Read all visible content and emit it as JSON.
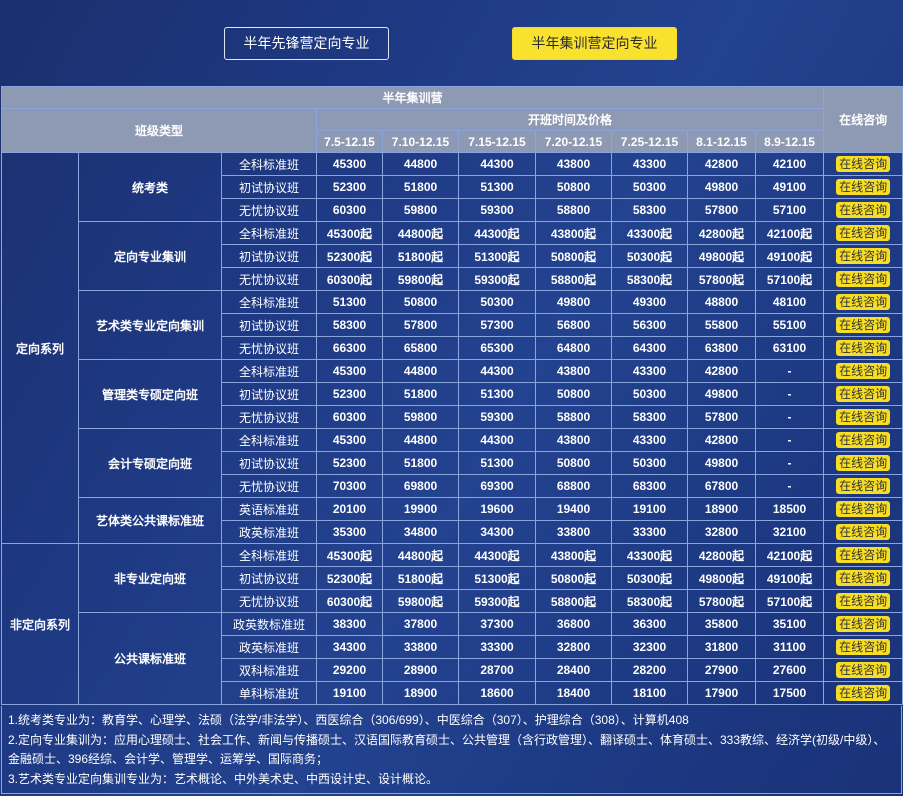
{
  "tabs": [
    {
      "label": "半年先锋营定向专业",
      "active": false
    },
    {
      "label": "半年集训营定向专业",
      "active": true
    }
  ],
  "table": {
    "title": "半年集训营",
    "class_type_header": "班级类型",
    "time_price_header": "开班时间及价格",
    "consult_header": "在线咨询",
    "periods": [
      "7.5-12.15",
      "7.10-12.15",
      "7.15-12.15",
      "7.20-12.15",
      "7.25-12.15",
      "8.1-12.15",
      "8.9-12.15"
    ],
    "consult_label": "在线咨询",
    "series": [
      {
        "name": "定向系列",
        "groups": [
          {
            "name": "统考类",
            "rows": [
              {
                "cls": "全科标准班",
                "prices": [
                  "45300",
                  "44800",
                  "44300",
                  "43800",
                  "43300",
                  "42800",
                  "42100"
                ]
              },
              {
                "cls": "初试协议班",
                "prices": [
                  "52300",
                  "51800",
                  "51300",
                  "50800",
                  "50300",
                  "49800",
                  "49100"
                ]
              },
              {
                "cls": "无忧协议班",
                "prices": [
                  "60300",
                  "59800",
                  "59300",
                  "58800",
                  "58300",
                  "57800",
                  "57100"
                ]
              }
            ]
          },
          {
            "name": "定向专业集训",
            "rows": [
              {
                "cls": "全科标准班",
                "prices": [
                  "45300起",
                  "44800起",
                  "44300起",
                  "43800起",
                  "43300起",
                  "42800起",
                  "42100起"
                ]
              },
              {
                "cls": "初试协议班",
                "prices": [
                  "52300起",
                  "51800起",
                  "51300起",
                  "50800起",
                  "50300起",
                  "49800起",
                  "49100起"
                ]
              },
              {
                "cls": "无忧协议班",
                "prices": [
                  "60300起",
                  "59800起",
                  "59300起",
                  "58800起",
                  "58300起",
                  "57800起",
                  "57100起"
                ]
              }
            ]
          },
          {
            "name": "艺术类专业定向集训",
            "rows": [
              {
                "cls": "全科标准班",
                "prices": [
                  "51300",
                  "50800",
                  "50300",
                  "49800",
                  "49300",
                  "48800",
                  "48100"
                ]
              },
              {
                "cls": "初试协议班",
                "prices": [
                  "58300",
                  "57800",
                  "57300",
                  "56800",
                  "56300",
                  "55800",
                  "55100"
                ]
              },
              {
                "cls": "无忧协议班",
                "prices": [
                  "66300",
                  "65800",
                  "65300",
                  "64800",
                  "64300",
                  "63800",
                  "63100"
                ]
              }
            ]
          },
          {
            "name": "管理类专硕定向班",
            "rows": [
              {
                "cls": "全科标准班",
                "prices": [
                  "45300",
                  "44800",
                  "44300",
                  "43800",
                  "43300",
                  "42800",
                  "-"
                ]
              },
              {
                "cls": "初试协议班",
                "prices": [
                  "52300",
                  "51800",
                  "51300",
                  "50800",
                  "50300",
                  "49800",
                  "-"
                ]
              },
              {
                "cls": "无忧协议班",
                "prices": [
                  "60300",
                  "59800",
                  "59300",
                  "58800",
                  "58300",
                  "57800",
                  "-"
                ]
              }
            ]
          },
          {
            "name": "会计专硕定向班",
            "rows": [
              {
                "cls": "全科标准班",
                "prices": [
                  "45300",
                  "44800",
                  "44300",
                  "43800",
                  "43300",
                  "42800",
                  "-"
                ]
              },
              {
                "cls": "初试协议班",
                "prices": [
                  "52300",
                  "51800",
                  "51300",
                  "50800",
                  "50300",
                  "49800",
                  "-"
                ]
              },
              {
                "cls": "无忧协议班",
                "prices": [
                  "70300",
                  "69800",
                  "69300",
                  "68800",
                  "68300",
                  "67800",
                  "-"
                ]
              }
            ]
          },
          {
            "name": "艺体类公共课标准班",
            "rows": [
              {
                "cls": "英语标准班",
                "prices": [
                  "20100",
                  "19900",
                  "19600",
                  "19400",
                  "19100",
                  "18900",
                  "18500"
                ]
              },
              {
                "cls": "政英标准班",
                "prices": [
                  "35300",
                  "34800",
                  "34300",
                  "33800",
                  "33300",
                  "32800",
                  "32100"
                ]
              }
            ]
          }
        ]
      },
      {
        "name": "非定向系列",
        "groups": [
          {
            "name": "非专业定向班",
            "rows": [
              {
                "cls": "全科标准班",
                "prices": [
                  "45300起",
                  "44800起",
                  "44300起",
                  "43800起",
                  "43300起",
                  "42800起",
                  "42100起"
                ]
              },
              {
                "cls": "初试协议班",
                "prices": [
                  "52300起",
                  "51800起",
                  "51300起",
                  "50800起",
                  "50300起",
                  "49800起",
                  "49100起"
                ]
              },
              {
                "cls": "无忧协议班",
                "prices": [
                  "60300起",
                  "59800起",
                  "59300起",
                  "58800起",
                  "58300起",
                  "57800起",
                  "57100起"
                ]
              }
            ]
          },
          {
            "name": "公共课标准班",
            "rows": [
              {
                "cls": "政英数标准班",
                "prices": [
                  "38300",
                  "37800",
                  "37300",
                  "36800",
                  "36300",
                  "35800",
                  "35100"
                ]
              },
              {
                "cls": "政英标准班",
                "prices": [
                  "34300",
                  "33800",
                  "33300",
                  "32800",
                  "32300",
                  "31800",
                  "31100"
                ]
              },
              {
                "cls": "双科标准班",
                "prices": [
                  "29200",
                  "28900",
                  "28700",
                  "28400",
                  "28200",
                  "27900",
                  "27600"
                ]
              },
              {
                "cls": "单科标准班",
                "prices": [
                  "19100",
                  "18900",
                  "18600",
                  "18400",
                  "18100",
                  "17900",
                  "17500"
                ]
              }
            ]
          }
        ]
      }
    ]
  },
  "notes": [
    "1.统考类专业为：教育学、心理学、法硕（法学/非法学）、西医综合（306/699）、中医综合（307）、护理综合（308）、计算机408",
    "2.定向专业集训为：应用心理硕士、社会工作、新闻与传播硕士、汉语国际教育硕士、公共管理（含行政管理）、翻译硕士、体育硕士、333教综、经济学(初级/中级）、金融硕士、396经综、会计学、管理学、运筹学、国际商务；",
    "3.艺术类专业定向集训专业为：艺术概论、中外美术史、中西设计史、设计概论。"
  ],
  "colors": {
    "background": "#1f3b86",
    "header_bg": "#8e9ab3",
    "grid_line": "#8aa4de",
    "accent_yellow": "#f9e22e"
  }
}
